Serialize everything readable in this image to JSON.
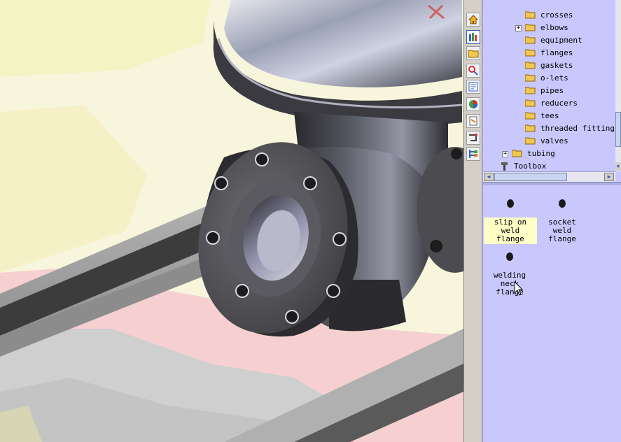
{
  "tree": {
    "items": [
      {
        "label": "crosses",
        "expander": ""
      },
      {
        "label": "elbows",
        "expander": "+"
      },
      {
        "label": "equipment",
        "expander": ""
      },
      {
        "label": "flanges",
        "expander": ""
      },
      {
        "label": "gaskets",
        "expander": ""
      },
      {
        "label": "o-lets",
        "expander": ""
      },
      {
        "label": "pipes",
        "expander": ""
      },
      {
        "label": "reducers",
        "expander": ""
      },
      {
        "label": "tees",
        "expander": ""
      },
      {
        "label": "threaded fittings",
        "expander": ""
      },
      {
        "label": "valves",
        "expander": ""
      },
      {
        "label": "tubing",
        "expander": "+"
      },
      {
        "label": "Toolbox",
        "expander": ""
      }
    ]
  },
  "taskpane_icons": [
    "home-icon",
    "design-library-icon",
    "file-explorer-icon",
    "search-icon",
    "view-palette-icon",
    "appearances-icon",
    "custom-properties-icon",
    "routing-icon",
    "library-tree-icon"
  ],
  "parts": [
    {
      "line1": "slip on",
      "line2": "weld flange",
      "selected": true
    },
    {
      "line1": "socket weld",
      "line2": "flange",
      "selected": false
    },
    {
      "line1": "welding",
      "line2": "neck flange",
      "selected": false
    }
  ],
  "colors": {
    "pane_background": "#c8c8ff",
    "selection_highlight": "#ffffc8",
    "folder": "#f0c850"
  }
}
